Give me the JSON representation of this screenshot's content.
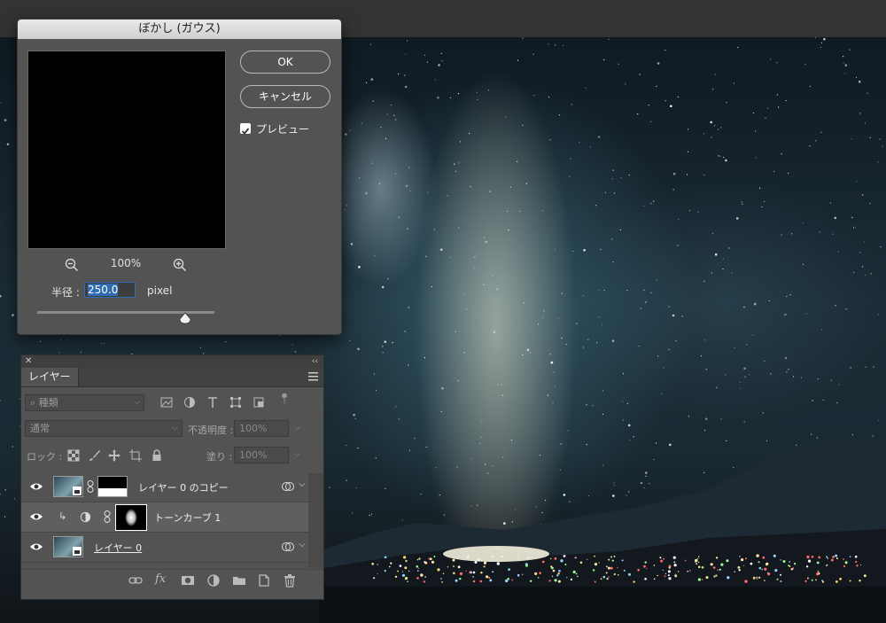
{
  "dialog": {
    "title": "ぼかし (ガウス)",
    "ok_label": "OK",
    "cancel_label": "キャンセル",
    "preview_label": "プレビュー",
    "preview_checked": true,
    "zoom_level": "100%",
    "radius_label": "半径 :",
    "radius_value": "250.0",
    "radius_unit": "pixel",
    "icons": [
      "zoom-out-icon",
      "zoom-in-icon",
      "slider-thumb-icon",
      "checkmark-icon"
    ]
  },
  "layers_panel": {
    "tab_label": "レイヤー",
    "filter_placeholder": "種類",
    "blend_mode": "通常",
    "opacity_label": "不透明度 :",
    "opacity_value": "100%",
    "lock_label": "ロック :",
    "fill_label": "塗り :",
    "fill_value": "100%",
    "layers": [
      {
        "name": "レイヤー 0 のコピー",
        "visible": true,
        "selected": false,
        "has_mask": true,
        "smart_object": true
      },
      {
        "name": "トーンカーブ 1",
        "visible": true,
        "selected": true,
        "adjustment": true,
        "clipped": true
      },
      {
        "name": "レイヤー 0",
        "visible": true,
        "selected": false,
        "smart_object": true
      }
    ],
    "icons": [
      "close-icon",
      "collapse-icon",
      "panel-menu-icon",
      "search-icon",
      "image-filter-icon",
      "adjustment-filter-icon",
      "type-filter-icon",
      "shape-filter-icon",
      "smart-object-filter-icon",
      "filter-toggle-icon",
      "lock-transparent-icon",
      "lock-paint-icon",
      "lock-position-icon",
      "lock-artboard-icon",
      "lock-all-icon",
      "eye-icon",
      "link-icon",
      "clip-icon",
      "adjustment-icon",
      "link-layers-icon",
      "fx-icon",
      "add-mask-icon",
      "new-adjustment-icon",
      "new-group-icon",
      "new-layer-icon",
      "delete-icon"
    ]
  },
  "colors": {
    "dialog_bg": "#535353",
    "selection_blue": "#2f6db3",
    "panel_bg": "#535353",
    "selected_row": "#5f5f5f"
  }
}
